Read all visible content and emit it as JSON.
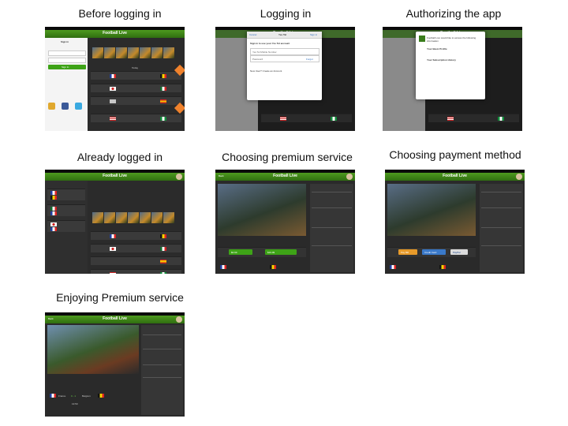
{
  "captions": [
    "Before logging in",
    "Logging in",
    "Authorizing the app",
    "Already logged in",
    "Choosing premium service",
    "Choosing payment method",
    "Enjoying Premium service"
  ],
  "app": {
    "title": "Football Live"
  },
  "screens": {
    "before_login": {
      "sign_in_title": "Sign in",
      "sign_in_button": "Sign In",
      "tab_today": "Today"
    },
    "logging_in": {
      "dialog_title": "Sign in to use your Yes Tel account",
      "mobile_number_placeholder": "Yes Tel Mobile Number",
      "password_placeholder": "Password",
      "forgot_link": "Forgot",
      "new_user_text": "New User? Create an Account",
      "cancel": "Cancel",
      "provider": "Yes Tel",
      "sign_in": "Sign in"
    },
    "authorizing": {
      "intro": "Football Live would like to access the following information",
      "item1": "Your Basic Profile",
      "item2": "Your Subscription History"
    },
    "premium": {
      "back": "Back",
      "offer1": "$0.99",
      "offer2": "$19.99"
    },
    "payment": {
      "pay_option1": "Pay Bill",
      "pay_option2": "Credit Card",
      "pay_option3": "PayPal"
    },
    "enjoying": {
      "team1": "France",
      "score": "0 - 1",
      "team2": "Belgium",
      "time": "13:50"
    }
  }
}
